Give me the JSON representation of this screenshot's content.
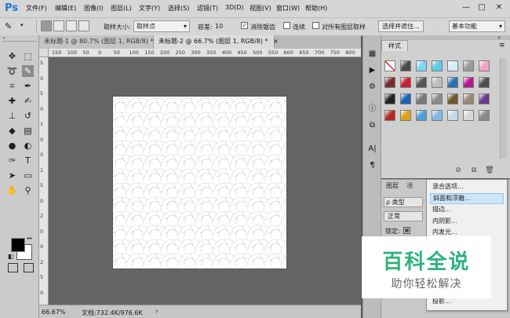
{
  "app": {
    "logo": "Ps"
  },
  "menu": [
    "文件(F)",
    "编辑(E)",
    "图像(I)",
    "图层(L)",
    "文字(Y)",
    "选择(S)",
    "滤镜(T)",
    "3D(D)",
    "视图(V)",
    "窗口(W)",
    "帮助(H)"
  ],
  "window_controls": {
    "minimize": "—",
    "maximize": "□",
    "close": "✕"
  },
  "options": {
    "sample_size_label": "取样大小:",
    "sample_size_value": "取样点",
    "tolerance_label": "容差:",
    "tolerance_value": "10",
    "antialias_label": "消除锯齿",
    "antialias_checked": true,
    "contiguous_label": "连续",
    "contiguous_checked": false,
    "all_layers_label": "对所有图层取样",
    "all_layers_checked": false,
    "refine_button": "选择并遮住...",
    "workspace_value": "基本功能"
  },
  "tabs": [
    {
      "label": "未标题-1 @ 80.7% (图层 1, RGB/8) *",
      "close": "×",
      "active": false
    },
    {
      "label": "未标题-2 @ 66.7% (图层 1, RGB/8) *",
      "close": "×",
      "active": true
    }
  ],
  "ruler_top_ticks": [
    "150",
    "100",
    "50",
    "0",
    "50",
    "100",
    "150",
    "200",
    "250",
    "300",
    "350",
    "400",
    "450",
    "500",
    "550",
    "600",
    "650",
    "700",
    "750",
    "800"
  ],
  "ruler_left_ticks": [
    "5",
    "0",
    "5",
    "0",
    "1",
    "0",
    "0",
    "1",
    "5",
    "0",
    "2",
    "0",
    "0",
    "2",
    "5",
    "0"
  ],
  "status": {
    "zoom": "66.67%",
    "doc_info": "文档:732.4K/976.6K",
    "arrow": "›"
  },
  "styles_panel": {
    "tab_label": "样式",
    "collapse": "»",
    "menu": "≡",
    "footer_icons": [
      "no-icon",
      "new-style-icon",
      "trash-icon"
    ],
    "swatch_colors": [
      [
        "none",
        "#4a4a4a",
        "#7fd6ee",
        "#5cc9e6",
        "#d4eef7",
        "#9a9a9a",
        "#f2a4c4"
      ],
      [
        "#7b2a2a",
        "#c51f3a",
        "#555555",
        "#bdbdbd",
        "#2a6fb5",
        "#b31b8c",
        "#4d4d4d"
      ],
      [
        "#222222",
        "#1a62b3",
        "#7a7a7a",
        "#8a8a8a",
        "#6e5a2e",
        "#9a8a7a",
        "#6a3a8a"
      ],
      [
        "#b7281e",
        "#d8a41e",
        "#4aa0d8",
        "#86b8e4",
        "#c8d8ea",
        "#d8d8d8",
        "#8a8a8a"
      ]
    ]
  },
  "layers_panel": {
    "tabs": [
      "图层",
      "通"
    ],
    "filter_label": "ρ 类型",
    "blend_mode": "正常",
    "lock_label": "锁定:",
    "lock_icon": "lock-icon"
  },
  "context_menu": {
    "items": [
      {
        "label": "混合选项...",
        "highlight": false
      },
      {
        "label": "斜面和浮雕...",
        "highlight": true
      },
      {
        "label": "描边...",
        "highlight": false
      },
      {
        "label": "内阴影...",
        "highlight": false
      },
      {
        "label": "内发光...",
        "highlight": false
      },
      {
        "label": "光泽...",
        "highlight": false
      },
      {
        "label": "颜色叠加...",
        "highlight": false
      },
      {
        "label": "渐变叠加...",
        "highlight": false
      },
      {
        "label": "图案叠加...",
        "highlight": false
      },
      {
        "label": "外发光...",
        "highlight": false
      },
      {
        "label": "投影...",
        "highlight": false
      }
    ]
  },
  "watermark": {
    "title": "百科全说",
    "subtitle": "助你轻松解决"
  }
}
